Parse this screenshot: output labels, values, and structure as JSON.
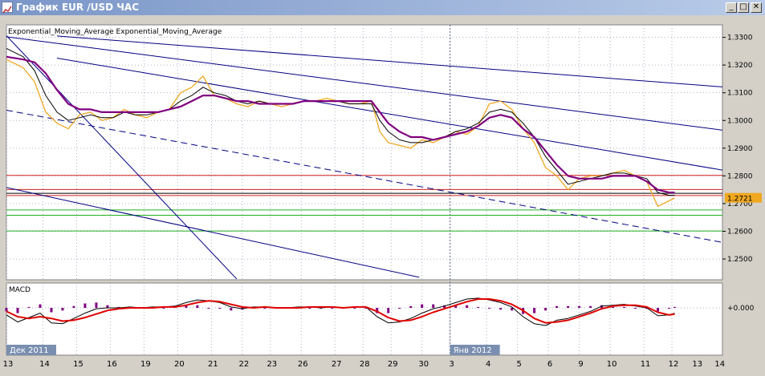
{
  "window": {
    "title": "График EUR /USD  ЧАС",
    "buttons": {
      "minimize": "_",
      "maximize": "□",
      "close": "✕"
    }
  },
  "colors": {
    "background": "#ffffff",
    "grid": "#aab2c4",
    "price": "#f0a820",
    "ema_fast": "#000000",
    "ema_slow": "#800080",
    "channel": "#000080",
    "resistance": "#d22020",
    "support": "#20b020",
    "macd_line": "#000000",
    "signal_line": "#e00000",
    "histogram": "#800080",
    "axis_text": "#000000",
    "label_bg": "#7a8fb0",
    "label_text": "#ffffff",
    "price_marker_bg": "#f0a820"
  },
  "chart_data": [
    {
      "type": "line",
      "legend": "Exponential_Moving_Average Exponential_Moving_Average",
      "ylim": [
        1.2425,
        1.3345
      ],
      "y_ticks": [
        1.33,
        1.32,
        1.31,
        1.3,
        1.29,
        1.28,
        1.27,
        1.26,
        1.25
      ],
      "y_tick_labels": [
        "1.3300",
        "1.3200",
        "1.3100",
        "1.3000",
        "1.2900",
        "1.2800",
        "1.2700",
        "1.2600",
        "1.2500"
      ],
      "x_ticks": [
        0,
        13,
        25,
        37,
        49,
        61,
        73,
        84,
        94,
        105,
        117,
        127,
        137,
        148,
        158,
        171,
        182,
        193,
        204,
        215,
        227,
        237
      ],
      "x_tick_labels": [
        "13",
        "14",
        "15",
        "16",
        "19",
        "20",
        "21",
        "22",
        "23",
        "26",
        "27",
        "28",
        "29",
        "30",
        "3",
        "4",
        "5",
        "6",
        "9",
        "10",
        "11",
        "12"
      ],
      "x_axis_extra_labels": [
        "13",
        "14"
      ],
      "period_labels": [
        "Дек 2011",
        "Янв 2012"
      ],
      "period_divider_x": 158,
      "current_price": 1.2721,
      "current_price_label": "1.2721",
      "series": [
        {
          "name": "Price",
          "x": [
            0,
            6,
            10,
            14,
            18,
            22,
            26,
            30,
            34,
            38,
            42,
            46,
            50,
            54,
            58,
            62,
            66,
            70,
            74,
            78,
            82,
            86,
            90,
            94,
            98,
            102,
            106,
            110,
            114,
            118,
            122,
            126,
            130,
            133,
            136,
            140,
            144,
            148,
            152,
            156,
            160,
            164,
            168,
            172,
            176,
            180,
            184,
            188,
            192,
            196,
            200,
            204,
            208,
            212,
            216,
            220,
            224,
            228,
            232,
            236,
            238
          ],
          "values": [
            1.322,
            1.319,
            1.314,
            1.303,
            1.299,
            1.297,
            1.302,
            1.303,
            1.3,
            1.301,
            1.304,
            1.302,
            1.301,
            1.303,
            1.304,
            1.31,
            1.312,
            1.316,
            1.309,
            1.308,
            1.306,
            1.305,
            1.307,
            1.306,
            1.305,
            1.306,
            1.307,
            1.307,
            1.308,
            1.307,
            1.306,
            1.306,
            1.307,
            1.296,
            1.292,
            1.291,
            1.29,
            1.293,
            1.292,
            1.294,
            1.296,
            1.295,
            1.298,
            1.306,
            1.307,
            1.304,
            1.297,
            1.292,
            1.283,
            1.28,
            1.275,
            1.279,
            1.28,
            1.28,
            1.281,
            1.282,
            1.28,
            1.278,
            1.269,
            1.271,
            1.272
          ]
        },
        {
          "name": "Exponential_Moving_Average",
          "x": [
            0,
            6,
            10,
            14,
            18,
            22,
            26,
            30,
            34,
            38,
            42,
            46,
            50,
            54,
            58,
            62,
            66,
            70,
            74,
            78,
            82,
            86,
            90,
            94,
            98,
            102,
            106,
            110,
            114,
            118,
            122,
            126,
            130,
            133,
            136,
            140,
            144,
            148,
            152,
            156,
            160,
            164,
            168,
            172,
            176,
            180,
            184,
            188,
            192,
            196,
            200,
            204,
            208,
            212,
            216,
            220,
            224,
            228,
            232,
            236,
            238
          ],
          "values": [
            1.326,
            1.323,
            1.318,
            1.309,
            1.303,
            1.3,
            1.301,
            1.302,
            1.301,
            1.301,
            1.303,
            1.302,
            1.302,
            1.303,
            1.304,
            1.307,
            1.309,
            1.312,
            1.31,
            1.309,
            1.307,
            1.306,
            1.307,
            1.306,
            1.306,
            1.306,
            1.307,
            1.307,
            1.307,
            1.307,
            1.306,
            1.306,
            1.306,
            1.3,
            1.296,
            1.293,
            1.292,
            1.292,
            1.293,
            1.294,
            1.296,
            1.297,
            1.299,
            1.303,
            1.304,
            1.303,
            1.299,
            1.294,
            1.287,
            1.282,
            1.277,
            1.278,
            1.279,
            1.28,
            1.281,
            1.281,
            1.28,
            1.279,
            1.274,
            1.273,
            1.273
          ]
        },
        {
          "name": "Exponential_Moving_Average",
          "x": [
            0,
            6,
            10,
            14,
            18,
            22,
            26,
            30,
            34,
            38,
            42,
            46,
            50,
            54,
            58,
            62,
            66,
            70,
            74,
            78,
            82,
            86,
            90,
            94,
            98,
            102,
            106,
            110,
            114,
            118,
            122,
            126,
            130,
            133,
            136,
            140,
            144,
            148,
            152,
            156,
            160,
            164,
            168,
            172,
            176,
            180,
            184,
            188,
            192,
            196,
            200,
            204,
            208,
            212,
            216,
            220,
            224,
            228,
            232,
            236,
            238
          ],
          "values": [
            1.323,
            1.322,
            1.321,
            1.317,
            1.311,
            1.306,
            1.304,
            1.304,
            1.303,
            1.303,
            1.303,
            1.303,
            1.303,
            1.303,
            1.304,
            1.305,
            1.307,
            1.309,
            1.309,
            1.308,
            1.307,
            1.307,
            1.306,
            1.306,
            1.306,
            1.306,
            1.307,
            1.307,
            1.307,
            1.307,
            1.307,
            1.307,
            1.307,
            1.303,
            1.299,
            1.296,
            1.294,
            1.294,
            1.293,
            1.294,
            1.295,
            1.296,
            1.298,
            1.301,
            1.302,
            1.301,
            1.297,
            1.294,
            1.289,
            1.284,
            1.28,
            1.279,
            1.279,
            1.279,
            1.28,
            1.28,
            1.28,
            1.278,
            1.275,
            1.274,
            1.274
          ]
        }
      ],
      "horizontal_lines": {
        "resistance": [
          1.2802,
          1.2751,
          1.2729
        ],
        "black": [
          1.2737
        ],
        "support": [
          1.2677,
          1.2658,
          1.2601
        ]
      },
      "trendlines": [
        {
          "style": "solid",
          "x": [
            18,
            255
          ],
          "values": [
            1.3305,
            1.3121
          ]
        },
        {
          "style": "solid",
          "x": [
            0,
            255
          ],
          "values": [
            1.3302,
            1.2965
          ]
        },
        {
          "style": "solid",
          "x": [
            18,
            255
          ],
          "values": [
            1.3225,
            1.2821
          ]
        },
        {
          "style": "dashed",
          "x": [
            0,
            255
          ],
          "values": [
            1.3037,
            1.256
          ]
        },
        {
          "style": "solid",
          "x": [
            0,
            147
          ],
          "values": [
            1.2758,
            1.2434
          ]
        },
        {
          "style": "solid",
          "x": [
            0,
            82
          ],
          "values": [
            1.3306,
            1.2428
          ]
        }
      ]
    },
    {
      "type": "line",
      "title": "MACD",
      "ylim": [
        -1,
        1
      ],
      "y_ticks": [
        0
      ],
      "y_tick_labels": [
        "+0.000"
      ],
      "series": [
        {
          "name": "MACD",
          "x": [
            0,
            4,
            8,
            12,
            16,
            20,
            24,
            28,
            32,
            36,
            40,
            44,
            48,
            52,
            56,
            60,
            64,
            68,
            72,
            76,
            80,
            84,
            88,
            92,
            96,
            100,
            104,
            108,
            112,
            116,
            120,
            124,
            128,
            132,
            136,
            140,
            144,
            148,
            152,
            156,
            160,
            164,
            168,
            172,
            176,
            180,
            184,
            188,
            192,
            196,
            200,
            204,
            208,
            212,
            216,
            220,
            224,
            228,
            232,
            236,
            238
          ],
          "values": [
            -0.4,
            -0.8,
            -0.55,
            -0.3,
            -0.85,
            -0.9,
            -0.6,
            -0.3,
            -0.05,
            0.0,
            0.0,
            0.05,
            0.0,
            0.05,
            0.05,
            0.1,
            0.3,
            0.45,
            0.4,
            0.3,
            0.05,
            -0.05,
            0.05,
            0.05,
            0.0,
            0.0,
            0.05,
            0.05,
            0.0,
            0.05,
            0.0,
            0.05,
            0.05,
            -0.5,
            -0.85,
            -0.8,
            -0.6,
            -0.3,
            -0.05,
            0.1,
            0.3,
            0.5,
            0.55,
            0.45,
            0.3,
            0.05,
            -0.5,
            -0.9,
            -1.0,
            -0.7,
            -0.6,
            -0.4,
            -0.2,
            0.1,
            0.15,
            0.2,
            0.1,
            0.0,
            -0.45,
            -0.4,
            -0.3
          ]
        },
        {
          "name": "Signal",
          "x": [
            0,
            4,
            8,
            12,
            16,
            20,
            24,
            28,
            32,
            36,
            40,
            44,
            48,
            52,
            56,
            60,
            64,
            68,
            72,
            76,
            80,
            84,
            88,
            92,
            96,
            100,
            104,
            108,
            112,
            116,
            120,
            124,
            128,
            132,
            136,
            140,
            144,
            148,
            152,
            156,
            160,
            164,
            168,
            172,
            176,
            180,
            184,
            188,
            192,
            196,
            200,
            204,
            208,
            212,
            216,
            220,
            224,
            228,
            232,
            236,
            238
          ],
          "values": [
            -0.2,
            -0.5,
            -0.6,
            -0.5,
            -0.6,
            -0.75,
            -0.7,
            -0.55,
            -0.35,
            -0.15,
            -0.05,
            0.0,
            0.0,
            0.0,
            0.05,
            0.05,
            0.15,
            0.3,
            0.4,
            0.35,
            0.2,
            0.05,
            0.0,
            0.05,
            0.0,
            0.0,
            0.0,
            0.05,
            0.05,
            0.05,
            0.0,
            0.05,
            0.05,
            -0.2,
            -0.55,
            -0.75,
            -0.7,
            -0.5,
            -0.25,
            -0.05,
            0.15,
            0.35,
            0.5,
            0.5,
            0.4,
            0.2,
            -0.15,
            -0.6,
            -0.85,
            -0.8,
            -0.7,
            -0.5,
            -0.3,
            -0.05,
            0.1,
            0.15,
            0.15,
            0.05,
            -0.25,
            -0.4,
            -0.35
          ]
        },
        {
          "name": "Histogram",
          "x": [
            0,
            4,
            8,
            12,
            16,
            20,
            24,
            28,
            32,
            36,
            40,
            44,
            48,
            52,
            56,
            60,
            64,
            68,
            72,
            76,
            80,
            84,
            88,
            92,
            96,
            100,
            104,
            108,
            112,
            116,
            120,
            124,
            128,
            132,
            136,
            140,
            144,
            148,
            152,
            156,
            160,
            164,
            168,
            172,
            176,
            180,
            184,
            188,
            192,
            196,
            200,
            204,
            208,
            212,
            216,
            220,
            224,
            228,
            232,
            236,
            238
          ],
          "values": [
            -0.2,
            -0.3,
            0.05,
            0.2,
            -0.25,
            -0.15,
            0.1,
            0.25,
            0.3,
            0.15,
            0.05,
            0.05,
            0.0,
            0.05,
            0.0,
            0.05,
            0.15,
            0.15,
            0.0,
            -0.05,
            -0.15,
            -0.1,
            0.05,
            0.0,
            0.0,
            0.0,
            0.05,
            0.0,
            -0.05,
            0.0,
            0.0,
            0.0,
            0.0,
            -0.3,
            -0.3,
            -0.05,
            0.1,
            0.2,
            0.2,
            0.15,
            0.15,
            0.15,
            0.05,
            -0.05,
            -0.1,
            -0.15,
            -0.35,
            -0.3,
            -0.15,
            0.1,
            0.1,
            0.1,
            0.1,
            0.15,
            0.05,
            0.05,
            -0.05,
            -0.05,
            -0.2,
            0.0,
            0.05
          ]
        }
      ]
    }
  ]
}
